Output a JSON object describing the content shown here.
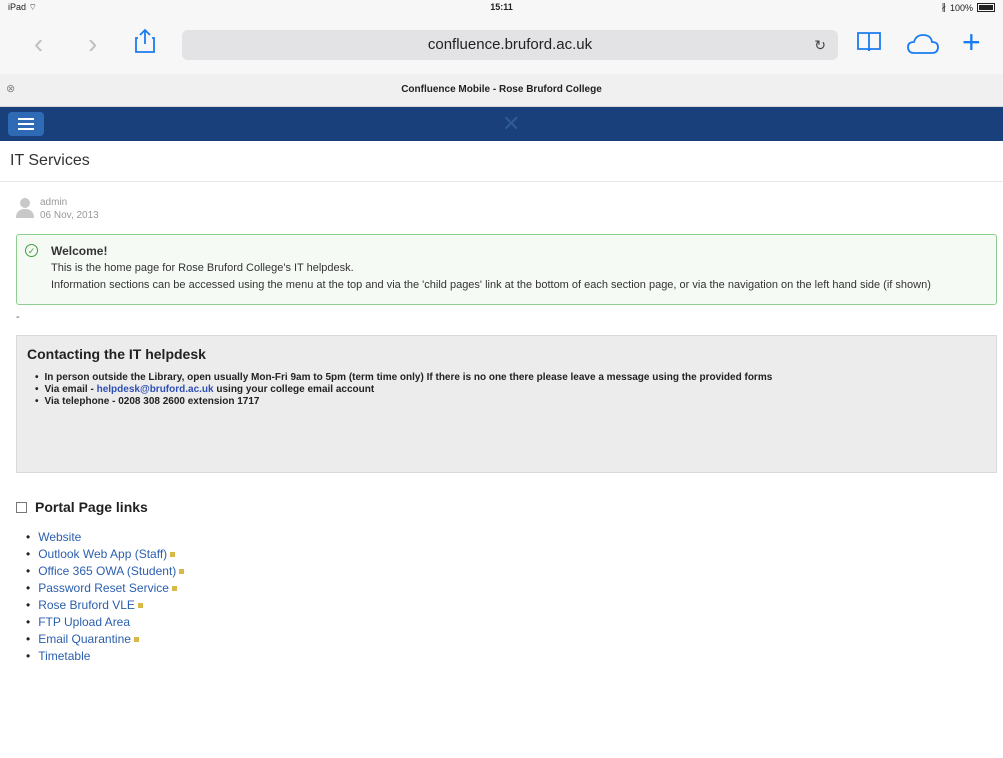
{
  "status": {
    "device": "iPad",
    "wifi_icon": "wifi-icon",
    "time": "15:11",
    "bluetooth_icon": "bluetooth-icon",
    "battery_percent": "100%"
  },
  "browser": {
    "url": "confluence.bruford.ac.uk",
    "tab_title": "Confluence Mobile - Rose Bruford College"
  },
  "page": {
    "title": "IT Services",
    "author": "admin",
    "date": "06 Nov, 2013",
    "welcome": {
      "title": "Welcome!",
      "line1": "This is the home page for Rose Bruford College's IT helpdesk.",
      "line2": "Information sections can be accessed using the menu at the top and via the 'child pages' link at the bottom of each section page, or via the navigation on the left hand side (if shown)"
    },
    "dash": "-",
    "contact": {
      "title": "Contacting the IT helpdesk",
      "item1": "In person outside the Library, open usually Mon-Fri 9am to 5pm (term time only) If there is no one there please leave a message using the provided forms",
      "item2_prefix": "Via email - ",
      "item2_link": "helpdesk@bruford.ac.uk",
      "item2_suffix": " using your college email account",
      "item3": "Via telephone - 0208 308 2600 extension 1717"
    },
    "portal": {
      "title": "Portal Page links",
      "links": [
        "Website",
        "Outlook Web App (Staff)",
        "Office 365 OWA (Student)",
        "Password Reset Service",
        "Rose Bruford VLE",
        "FTP Upload Area",
        "Email Quarantine",
        "Timetable"
      ]
    }
  }
}
